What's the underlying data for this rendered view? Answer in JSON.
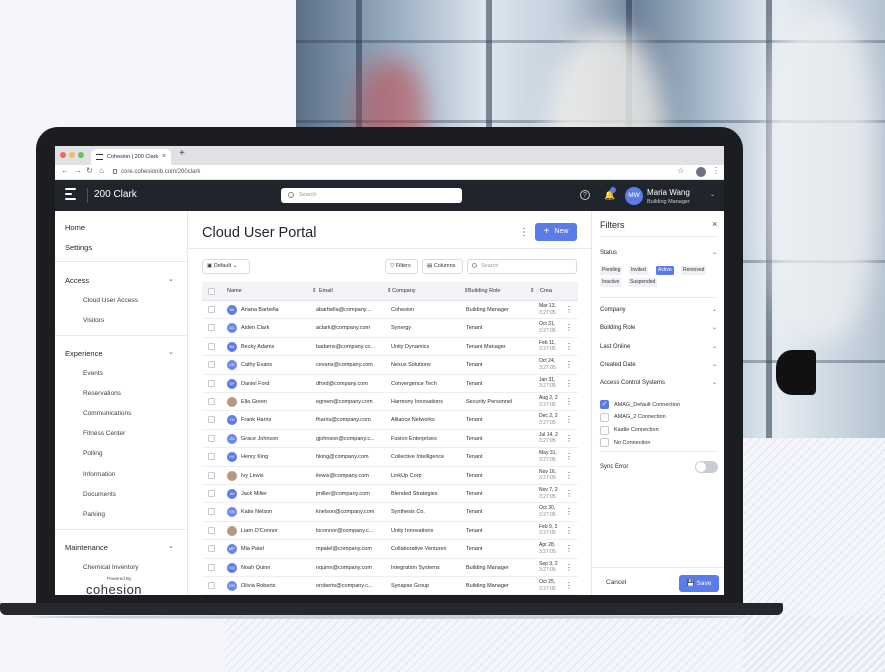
{
  "browser": {
    "tab_title": "Cohesion | 200 Clark",
    "tab_close": "×",
    "new_tab": "+",
    "url": "core.cohesionib.com/200clark"
  },
  "header": {
    "site_name": "200 Clark",
    "search_placeholder": "Search",
    "help": "?",
    "user": {
      "initials": "MW",
      "name": "Maria Wang",
      "role": "Building Manager"
    }
  },
  "sidebar": {
    "top_items": [
      {
        "label": "Home"
      },
      {
        "label": "Settings"
      }
    ],
    "access": {
      "label": "Access",
      "items": [
        {
          "label": "Cloud User Access"
        },
        {
          "label": "Visitors"
        }
      ]
    },
    "experience": {
      "label": "Experience",
      "items": [
        {
          "label": "Events"
        },
        {
          "label": "Reservations"
        },
        {
          "label": "Communications"
        },
        {
          "label": "Fitness Center"
        },
        {
          "label": "Polling"
        },
        {
          "label": "Information"
        },
        {
          "label": "Documents"
        },
        {
          "label": "Parking"
        }
      ]
    },
    "maintenance": {
      "label": "Maintenance",
      "items": [
        {
          "label": "Chemical Inventory"
        }
      ]
    },
    "powered_by": "Powered By",
    "brand": "cohesion"
  },
  "main": {
    "title": "Cloud User Portal",
    "new_button": "New",
    "new_icon": "+",
    "view_select": "Default",
    "filters_button": "Filters",
    "columns_button": "Columns",
    "search_placeholder": "Search",
    "columns": {
      "name": "Name",
      "email": "Email",
      "company": "Company",
      "role": "Building Role",
      "created": "Crea"
    },
    "rows": [
      {
        "initials": "BK",
        "name": "Ariana Barbella",
        "email": "abarbella@company....",
        "company": "Cohesion",
        "role": "Building Manager",
        "date": "Mar 13,",
        "time": "3:27:05"
      },
      {
        "initials": "AC",
        "name": "Aiden Clark",
        "email": "aclark@company.com",
        "company": "Synergy",
        "role": "Tenant",
        "date": "Oct 31,",
        "time": "3:27:05"
      },
      {
        "initials": "BA",
        "name": "Becky Adams",
        "email": "badams@company.co...",
        "company": "Unity Dynamics",
        "role": "Tenant Manager",
        "date": "Feb 11,",
        "time": "3:27:05"
      },
      {
        "initials": "CE",
        "name": "Cathy Evans",
        "email": "cevans@company.com",
        "company": "Nexus Solutions",
        "role": "Tenant",
        "date": "Oct 24,",
        "time": "3:27:05"
      },
      {
        "initials": "DF",
        "name": "Daniel Ford",
        "email": "dford@company.com",
        "company": "Convergence Tech",
        "role": "Tenant",
        "date": "Jan 31,",
        "time": "3:27:05"
      },
      {
        "initials": "",
        "name": "Ella Green",
        "email": "egreen@company.com",
        "company": "Harmony Innovations",
        "role": "Security Personnel",
        "date": "Aug 2, 2",
        "time": "3:27:05"
      },
      {
        "initials": "FH",
        "name": "Frank Harris",
        "email": "fharris@company.com",
        "company": "Alliance Networks",
        "role": "Tenant",
        "date": "Dec 2, 2",
        "time": "3:27:05"
      },
      {
        "initials": "GJ",
        "name": "Grace Johnson",
        "email": "gjohnson@company.c...",
        "company": "Fusion Enterprises",
        "role": "Tenant",
        "date": "Jul 14, 2",
        "time": "3:27:05"
      },
      {
        "initials": "HK",
        "name": "Henry King",
        "email": "hking@company.com",
        "company": "Collective Intelligence",
        "role": "Tenant",
        "date": "May 31,",
        "time": "3:27:05"
      },
      {
        "initials": "",
        "name": "Ivy Lewis",
        "email": "ilewis@company.com",
        "company": "LinkUp Corp",
        "role": "Tenant",
        "date": "Nov 16,",
        "time": "3:27:05"
      },
      {
        "initials": "JM",
        "name": "Jack Miller",
        "email": "jmiller@company.com",
        "company": "Blended Strategies",
        "role": "Tenant",
        "date": "Nov 7, 2",
        "time": "3:27:05"
      },
      {
        "initials": "KN",
        "name": "Katie Nelson",
        "email": "knelson@company.com",
        "company": "Synthesis Co.",
        "role": "Tenant",
        "date": "Oct 30,",
        "time": "3:27:05"
      },
      {
        "initials": "",
        "name": "Liam O'Connor",
        "email": "loconnor@company.c...",
        "company": "Unity Innovations",
        "role": "Tenant",
        "date": "Feb 9, 2",
        "time": "3:27:05"
      },
      {
        "initials": "MP",
        "name": "Mia Patel",
        "email": "mpatel@company.com",
        "company": "Collaborative Ventures",
        "role": "Tenant",
        "date": "Apr 28,",
        "time": "3:27:05"
      },
      {
        "initials": "NQ",
        "name": "Noah Quinn",
        "email": "nquinn@company.com",
        "company": "Integration Systems",
        "role": "Building Manager",
        "date": "Sep 9, 2",
        "time": "3:27:05"
      },
      {
        "initials": "OR",
        "name": "Olivia Roberts",
        "email": "oroberts@company.c...",
        "company": "Synapse Group",
        "role": "Building Manager",
        "date": "Oct 25,",
        "time": "3:27:05"
      }
    ]
  },
  "filters": {
    "title": "Filters",
    "close": "×",
    "status_label": "Status",
    "status_chips": [
      {
        "label": "Pending",
        "active": false
      },
      {
        "label": "Invited",
        "active": false
      },
      {
        "label": "Active",
        "active": true
      },
      {
        "label": "Removed",
        "active": false
      },
      {
        "label": "Inactive",
        "active": false
      },
      {
        "label": "Suspended",
        "active": false
      }
    ],
    "sections": [
      {
        "label": "Company"
      },
      {
        "label": "Building Role"
      },
      {
        "label": "Last Online"
      },
      {
        "label": "Created Date"
      },
      {
        "label": "Access Control Systems"
      }
    ],
    "systems": [
      {
        "label": "AMAG_Default Connection",
        "checked": true
      },
      {
        "label": "AMAG_2 Connection",
        "checked": false
      },
      {
        "label": "Kastle Connection",
        "checked": false
      },
      {
        "label": "No Connection",
        "checked": false
      }
    ],
    "sync_error_label": "Sync Error",
    "sync_error_on": false,
    "cancel": "Cancel",
    "save": "Save"
  },
  "colors": {
    "accent": "#5b7be8",
    "header_bg": "#20242b",
    "laptop": "#1b1d21"
  },
  "icons": [
    "menu-icon",
    "search-icon",
    "help-icon",
    "bell-icon",
    "chevron-down-icon",
    "kebab-icon",
    "plus-icon",
    "filter-icon",
    "columns-icon",
    "sort-icon",
    "check-icon",
    "close-icon",
    "save-icon"
  ]
}
